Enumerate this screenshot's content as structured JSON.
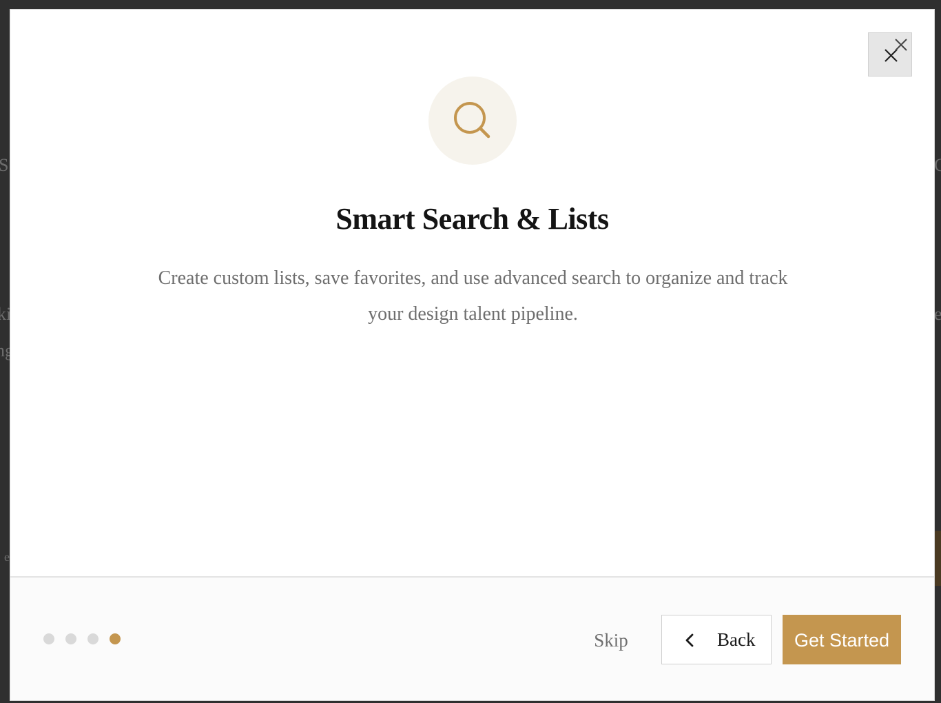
{
  "background": {
    "fragments": [
      "S",
      "C",
      "ki",
      "e",
      "ng",
      "e",
      "e"
    ]
  },
  "modal": {
    "close_icon": "close-icon",
    "feature_icon": "search-icon",
    "title": "Smart Search & Lists",
    "description": "Create custom lists, save favorites, and use advanced search to organize and track your design talent pipeline."
  },
  "footer": {
    "steps_total": 4,
    "current_step": 4,
    "skip_label": "Skip",
    "back_label": "Back",
    "back_icon": "chevron-left-icon",
    "primary_label": "Get Started"
  },
  "colors": {
    "accent": "#c4964f",
    "icon_bg": "#f6f3ec",
    "dot_inactive": "#d9d9d9"
  }
}
